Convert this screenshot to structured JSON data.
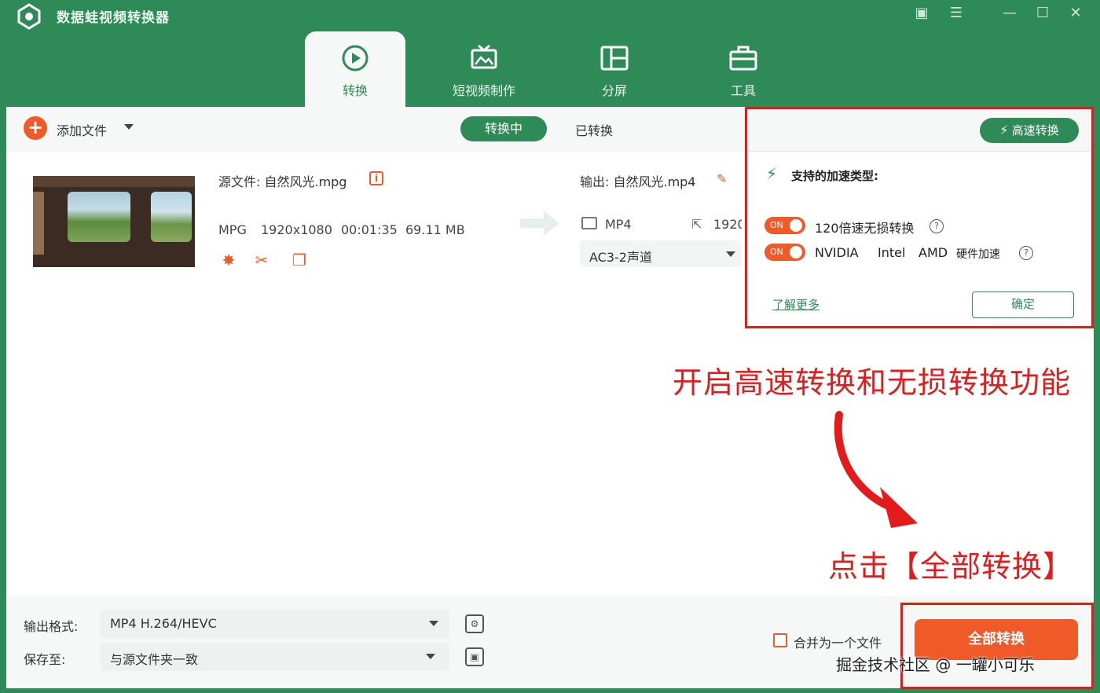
{
  "app": {
    "title": "数据蛙视频转换器"
  },
  "tabs": [
    {
      "label": "转换",
      "icon": "convert-icon"
    },
    {
      "label": "短视频制作",
      "icon": "tv-icon"
    },
    {
      "label": "分屏",
      "icon": "split-screen-icon"
    },
    {
      "label": "工具",
      "icon": "toolbox-icon"
    }
  ],
  "toolbar": {
    "add_file_label": "添加文件",
    "seg_converting": "转换中",
    "seg_converted": "已转换"
  },
  "file": {
    "source_label": "源文件: 自然风光.mpg",
    "format": "MPG",
    "resolution": "1920x1080",
    "duration": "00:01:35",
    "size": "69.11 MB",
    "output_label": "输出: 自然风光.mp4",
    "output_format": "MP4",
    "output_resolution": "1920",
    "audio": "AC3-2声道"
  },
  "popup": {
    "speed_button": "高速转换",
    "heading": "支持的加速类型:",
    "toggle_on": "ON",
    "option1": "120倍速无损转换",
    "option2_nvidia": "NVIDIA",
    "option2_intel": "Intel",
    "option2_amd": "AMD",
    "option2_suffix": "硬件加速",
    "learn_more": "了解更多",
    "ok": "确定"
  },
  "annotations": {
    "enable_hint": "开启高速转换和无损转换功能",
    "click_hint": "点击【全部转换】"
  },
  "bottom": {
    "output_format_label": "输出格式:",
    "output_format_value": "MP4 H.264/HEVC",
    "save_to_label": "保存至:",
    "save_to_value": "与源文件夹一致",
    "merge_label": "合并为一个文件",
    "convert_all": "全部转换"
  },
  "watermark": "掘金技术社区 @ 一罐小可乐",
  "colors": {
    "brand_green": "#2e8a57",
    "accent_orange": "#f05a28",
    "annotation_red": "#e31b1b"
  }
}
